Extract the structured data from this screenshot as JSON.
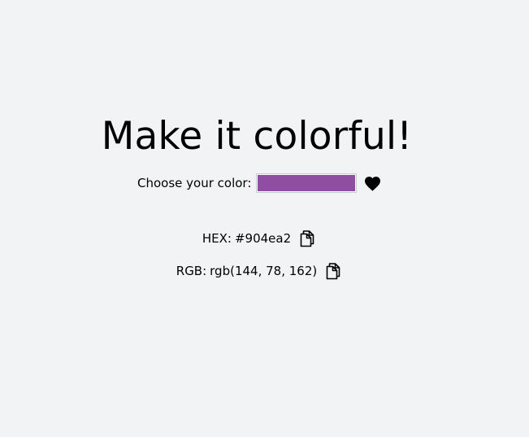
{
  "heading": "Make it colorful!",
  "picker": {
    "label": "Choose your color:",
    "value": "#904ea2"
  },
  "favorite": {
    "icon": "heart-icon"
  },
  "hex": {
    "label": "HEX:",
    "value": "#904ea2",
    "copy_icon": "copy-icon"
  },
  "rgb": {
    "label": "RGB:",
    "value": "rgb(144, 78, 162)",
    "copy_icon": "copy-icon"
  },
  "colors": {
    "background": "#f2f3f5",
    "selected": "#904ea2",
    "text": "#000000"
  }
}
